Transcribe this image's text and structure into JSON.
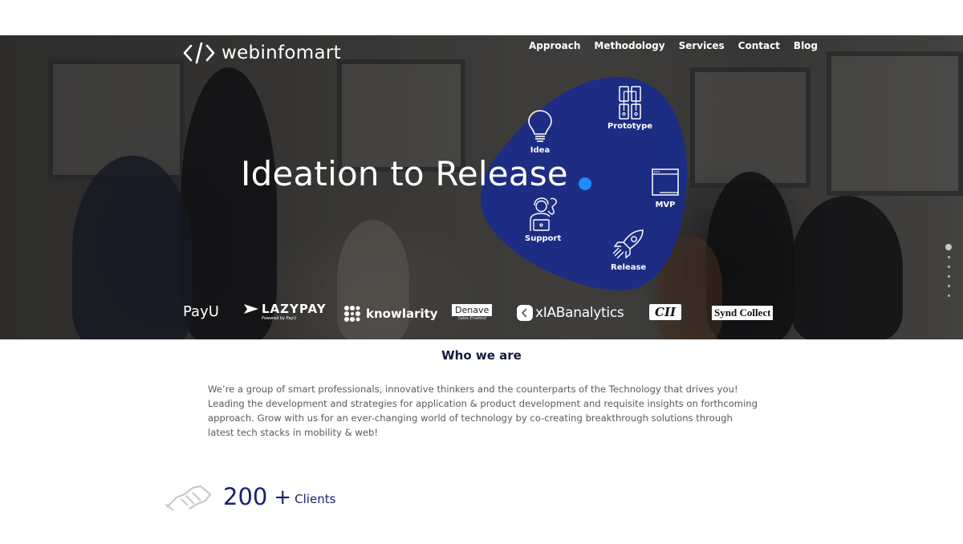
{
  "brand": {
    "name": "webinfomart",
    "logo_icon": "code-brackets-icon"
  },
  "nav": {
    "items": [
      {
        "label": "Approach"
      },
      {
        "label": "Methodology"
      },
      {
        "label": "Services"
      },
      {
        "label": "Contact"
      },
      {
        "label": "Blog"
      }
    ]
  },
  "hero": {
    "title": "Ideation to Release",
    "accent_color": "#1e8cff",
    "blob_color": "#1b2b8a",
    "steps": [
      {
        "label": "Idea",
        "icon": "lightbulb-icon"
      },
      {
        "label": "Prototype",
        "icon": "prototype-icon"
      },
      {
        "label": "MVP",
        "icon": "browser-window-icon"
      },
      {
        "label": "Release",
        "icon": "rocket-icon"
      },
      {
        "label": "Support",
        "icon": "support-person-icon"
      }
    ],
    "slider": {
      "total": 6,
      "active": 1
    }
  },
  "clients_logos": [
    {
      "name": "PayU",
      "text": "PayU"
    },
    {
      "name": "LazyPay",
      "text": "LAZYPAY",
      "subtext": "Powered by PayU"
    },
    {
      "name": "knowlarity",
      "text": "knowlarity"
    },
    {
      "name": "Denave",
      "text": "Denave",
      "subtext": "Sales Enabled"
    },
    {
      "name": "xIAB analytics",
      "text": "xIABanalytics"
    },
    {
      "name": "CII",
      "text": "CII"
    },
    {
      "name": "Synd Collect",
      "text": "Synd Collect"
    }
  ],
  "about": {
    "title": "Who we are",
    "body": "We’re a group of smart professionals, innovative thinkers and the counterparts of the Technology that drives you! Leading the development and strategies for application & product development and requisite insights on forthcoming approach. Grow with us for an ever-changing world of technology by co-creating breakthrough solutions through latest tech stacks in mobility & web!"
  },
  "stats": {
    "clients": {
      "value": "200",
      "plus": "+",
      "label": "Clients",
      "icon": "handshake-icon"
    }
  }
}
